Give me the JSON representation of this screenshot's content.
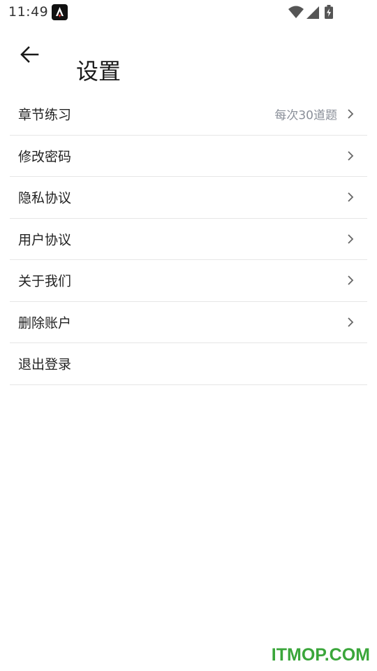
{
  "status_bar": {
    "time": "11:49",
    "app_icon": "a-launcher-icon",
    "icons": [
      "wifi-icon",
      "cellular-signal-icon",
      "battery-charging-icon"
    ]
  },
  "header": {
    "back_icon": "arrow-left-icon",
    "title": "设置"
  },
  "settings": {
    "items": [
      {
        "label": "章节练习",
        "value": "每次30道题",
        "chevron": true
      },
      {
        "label": "修改密码",
        "value": "",
        "chevron": true
      },
      {
        "label": "隐私协议",
        "value": "",
        "chevron": true
      },
      {
        "label": "用户协议",
        "value": "",
        "chevron": true
      },
      {
        "label": "关于我们",
        "value": "",
        "chevron": true
      },
      {
        "label": "删除账户",
        "value": "",
        "chevron": true
      },
      {
        "label": "退出登录",
        "value": "",
        "chevron": false
      }
    ]
  },
  "watermark": "ITMOP.COM",
  "colors": {
    "text": "#222222",
    "secondary_text": "#8a8f99",
    "divider": "#e6e6e6",
    "watermark": "#3aa63a"
  }
}
